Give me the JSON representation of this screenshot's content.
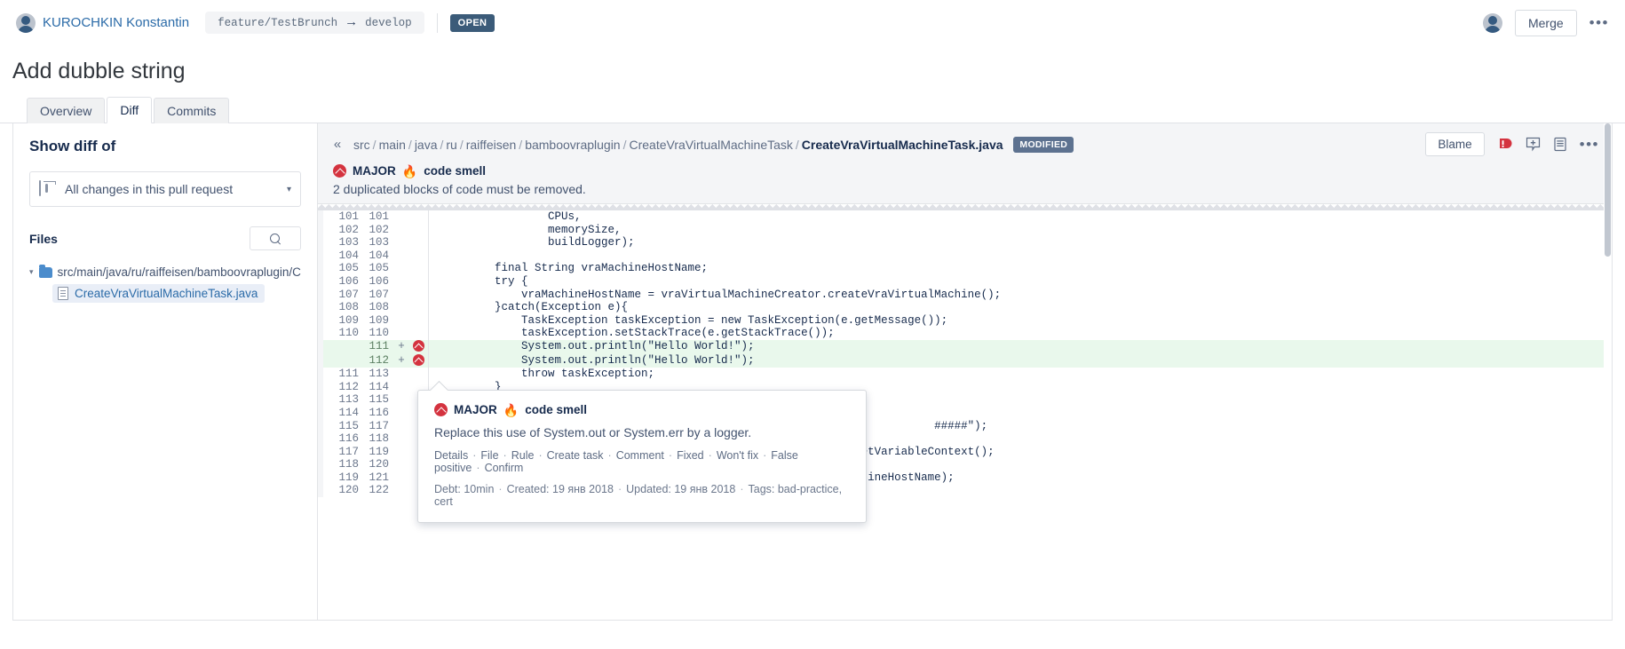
{
  "topbar": {
    "author": "KUROCHKIN Konstantin",
    "source_branch": "feature/TestBrunch",
    "arrow": "→",
    "target_branch": "develop",
    "status_badge": "OPEN",
    "merge_label": "Merge",
    "more_label": "•••"
  },
  "page": {
    "title": "Add dubble string",
    "tabs": [
      {
        "label": "Overview",
        "active": false
      },
      {
        "label": "Diff",
        "active": true
      },
      {
        "label": "Commits",
        "active": false
      }
    ]
  },
  "sidebar": {
    "heading": "Show diff of",
    "diff_scope_value": "All changes in this pull request",
    "chevron": "▾",
    "files_label": "Files",
    "search_placeholder": "",
    "collapse_icon": "«",
    "tree": {
      "folder": "src/main/java/ru/raiffeisen/bamboovraplugin/CreateVra",
      "folder_caret": "▾",
      "file": "CreateVraVirtualMachineTask.java"
    }
  },
  "diff_header": {
    "collapse_icon": "«",
    "crumbs": [
      "src",
      "main",
      "java",
      "ru",
      "raiffeisen",
      "bamboovraplugin",
      "CreateVraVirtualMachineTask"
    ],
    "current_file": "CreateVraVirtualMachineTask.java",
    "modified_badge": "MODIFIED",
    "blame_label": "Blame",
    "more_label": "•••",
    "severity": "MAJOR",
    "issue_type": "code smell",
    "issue_message": "2 duplicated blocks of code must be removed."
  },
  "popup": {
    "severity": "MAJOR",
    "issue_type": "code smell",
    "description": "Replace this use of System.out or System.err by a logger.",
    "actions": [
      "Details",
      "File",
      "Rule",
      "Create task",
      "Comment",
      "Fixed",
      "Won't fix",
      "False positive",
      "Confirm"
    ],
    "debt": "Debt: 10min",
    "created": "Created: 19 янв 2018",
    "updated": "Updated: 19 янв 2018",
    "tags": "Tags: bad-practice, cert"
  },
  "code": {
    "lines": [
      {
        "left": "101",
        "right": "101",
        "mark": "",
        "added": false,
        "issue": false,
        "text": "                CPUs,"
      },
      {
        "left": "102",
        "right": "102",
        "mark": "",
        "added": false,
        "issue": false,
        "text": "                memorySize,"
      },
      {
        "left": "103",
        "right": "103",
        "mark": "",
        "added": false,
        "issue": false,
        "text": "                buildLogger);"
      },
      {
        "left": "104",
        "right": "104",
        "mark": "",
        "added": false,
        "issue": false,
        "text": ""
      },
      {
        "left": "105",
        "right": "105",
        "mark": "",
        "added": false,
        "issue": false,
        "text": "        final String vraMachineHostName;"
      },
      {
        "left": "106",
        "right": "106",
        "mark": "",
        "added": false,
        "issue": false,
        "text": "        try {"
      },
      {
        "left": "107",
        "right": "107",
        "mark": "",
        "added": false,
        "issue": false,
        "text": "            vraMachineHostName = vraVirtualMachineCreator.createVraVirtualMachine();"
      },
      {
        "left": "108",
        "right": "108",
        "mark": "",
        "added": false,
        "issue": false,
        "text": "        }catch(Exception e){"
      },
      {
        "left": "109",
        "right": "109",
        "mark": "",
        "added": false,
        "issue": false,
        "text": "            TaskException taskException = new TaskException(e.getMessage());"
      },
      {
        "left": "110",
        "right": "110",
        "mark": "",
        "added": false,
        "issue": false,
        "text": "            taskException.setStackTrace(e.getStackTrace());"
      },
      {
        "left": "",
        "right": "111",
        "mark": "+",
        "added": true,
        "issue": true,
        "text": "            System.out.println(\"Hello World!\");"
      },
      {
        "left": "",
        "right": "112",
        "mark": "+",
        "added": true,
        "issue": true,
        "text": "            System.out.println(\"Hello World!\");"
      },
      {
        "left": "111",
        "right": "113",
        "mark": "",
        "added": false,
        "issue": false,
        "text": "            throw taskException;"
      },
      {
        "left": "112",
        "right": "114",
        "mark": "",
        "added": false,
        "issue": false,
        "text": "        }"
      },
      {
        "left": "113",
        "right": "115",
        "mark": "",
        "added": false,
        "issue": false,
        "text": ""
      },
      {
        "left": "114",
        "right": "116",
        "mark": "",
        "added": false,
        "issue": false,
        "text": ""
      },
      {
        "left": "115",
        "right": "117",
        "mark": "",
        "added": false,
        "issue": false,
        "text": "                                                                          #####\");"
      },
      {
        "left": "116",
        "right": "118",
        "mark": "",
        "added": false,
        "issue": false,
        "text": ""
      },
      {
        "left": "117",
        "right": "119",
        "mark": "",
        "added": false,
        "issue": false,
        "text": "                                                              getVariableContext();"
      },
      {
        "left": "118",
        "right": "120",
        "mark": "",
        "added": false,
        "issue": false,
        "text": ""
      },
      {
        "left": "119",
        "right": "121",
        "mark": "",
        "added": false,
        "issue": false,
        "text": "        planVariables.addResultVariable(\"VRA.Host.Name\", vraMachineHostName);"
      },
      {
        "left": "120",
        "right": "122",
        "mark": "",
        "added": false,
        "issue": false,
        "text": ""
      }
    ]
  }
}
